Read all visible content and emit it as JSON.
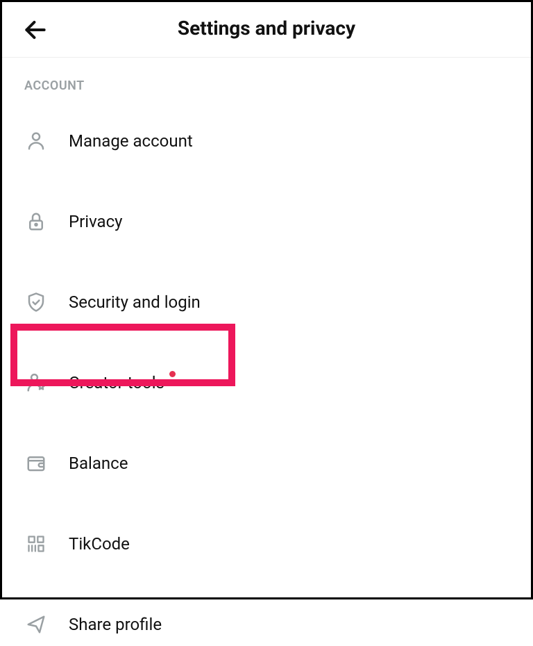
{
  "header": {
    "title": "Settings and privacy"
  },
  "section": {
    "label": "ACCOUNT",
    "items": [
      {
        "label": "Manage account"
      },
      {
        "label": "Privacy"
      },
      {
        "label": "Security and login"
      },
      {
        "label": "Creator tools",
        "has_dot": true
      },
      {
        "label": "Balance"
      },
      {
        "label": "TikCode"
      },
      {
        "label": "Share profile"
      }
    ]
  }
}
